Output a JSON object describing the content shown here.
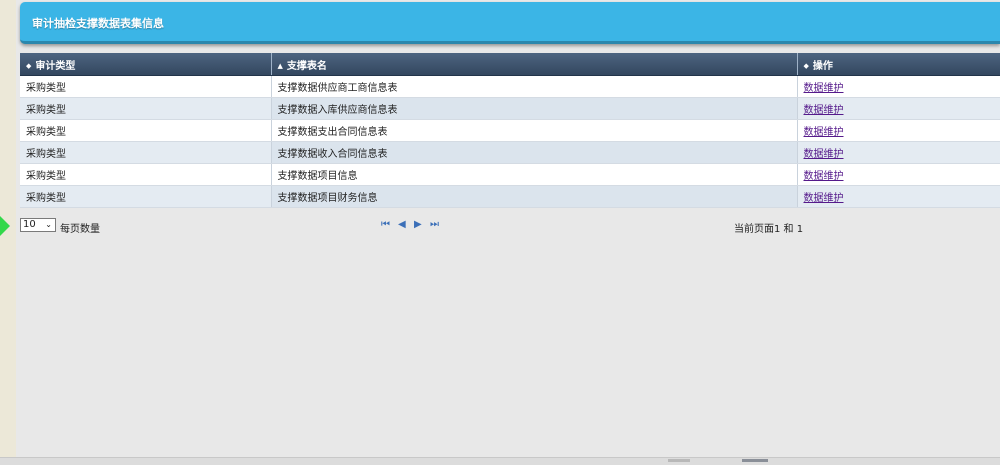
{
  "header": {
    "title": "审计抽检支撑数据表集信息"
  },
  "table": {
    "columns": [
      {
        "label": "审计类型",
        "sort_icon": "sort-both-icon"
      },
      {
        "label": "支撑表名",
        "sort_icon": "sort-asc-icon"
      },
      {
        "label": "操作",
        "sort_icon": "sort-both-icon"
      }
    ],
    "rows": [
      {
        "type": "采购类型",
        "table_name": "支撑数据供应商工商信息表",
        "action": "数据维护"
      },
      {
        "type": "采购类型",
        "table_name": "支撑数据入库供应商信息表",
        "action": "数据维护"
      },
      {
        "type": "采购类型",
        "table_name": "支撑数据支出合同信息表",
        "action": "数据维护"
      },
      {
        "type": "采购类型",
        "table_name": "支撑数据收入合同信息表",
        "action": "数据维护"
      },
      {
        "type": "采购类型",
        "table_name": "支撑数据项目信息",
        "action": "数据维护"
      },
      {
        "type": "采购类型",
        "table_name": "支撑数据项目财务信息",
        "action": "数据维护"
      }
    ]
  },
  "pager": {
    "page_size": "10",
    "page_size_label": "每页数量",
    "page_info": "当前页面1 和 1",
    "icons": [
      "first-page-icon",
      "prev-page-icon",
      "next-page-icon",
      "last-page-icon"
    ]
  },
  "colors": {
    "title_bar": "#3bb5e6",
    "header_bg": "#3d5270",
    "link": "#551a8b",
    "indicator": "#33d84a"
  }
}
